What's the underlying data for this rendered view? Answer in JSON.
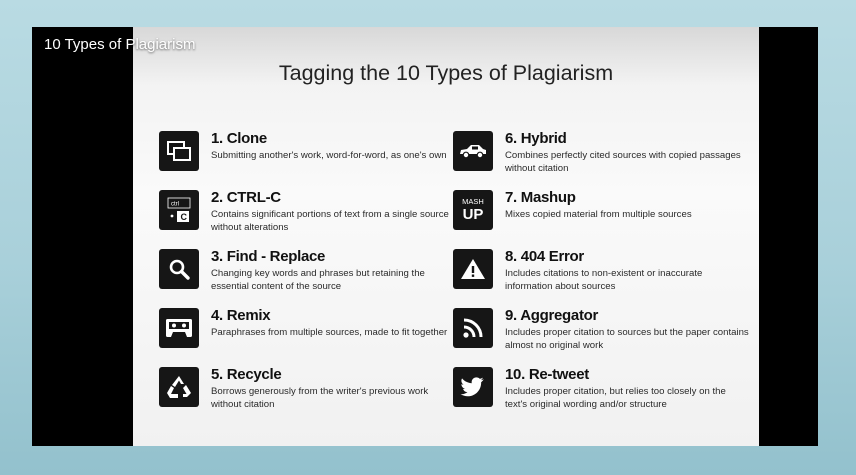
{
  "video": {
    "title": "10 Types of Plagiarism"
  },
  "slide": {
    "title": "Tagging the 10 Types of Plagiarism",
    "items": [
      {
        "name": "1. Clone",
        "desc": "Submitting another's work, word-for-word, as one's own",
        "icon": "clone-icon"
      },
      {
        "name": "2. CTRL-C",
        "desc": "Contains significant portions of text from a single source without alterations",
        "icon": "keyboard-ctrl-c-icon",
        "icon_text_top": "ctrl",
        "icon_text_bottom": "C"
      },
      {
        "name": "3. Find - Replace",
        "desc": "Changing key words and phrases but retaining the essential content of the source",
        "icon": "magnifier-icon"
      },
      {
        "name": "4. Remix",
        "desc": "Paraphrases from multiple sources, made to fit together",
        "icon": "cassette-icon"
      },
      {
        "name": "5. Recycle",
        "desc": "Borrows generously from the writer's previous work without citation",
        "icon": "recycle-icon"
      },
      {
        "name": "6. Hybrid",
        "desc": "Combines perfectly cited sources with copied passages without citation",
        "icon": "car-icon"
      },
      {
        "name": "7. Mashup",
        "desc": "Mixes copied material from multiple sources",
        "icon": "mashup-icon",
        "icon_text_top": "MASH",
        "icon_text_bottom": "UP"
      },
      {
        "name": "8. 404 Error",
        "desc": "Includes citations to non-existent or inaccurate information about sources",
        "icon": "warning-icon"
      },
      {
        "name": "9. Aggregator",
        "desc": "Includes proper citation to sources but the paper contains almost no original work",
        "icon": "rss-icon"
      },
      {
        "name": "10. Re-tweet",
        "desc": "Includes proper citation, but relies too closely on the text's original wording and/or structure",
        "icon": "twitter-bird-icon"
      }
    ]
  },
  "colors": {
    "icon_bg": "#161616",
    "slide_bg": "#f5f5f5",
    "frame_bg": "#000000"
  }
}
